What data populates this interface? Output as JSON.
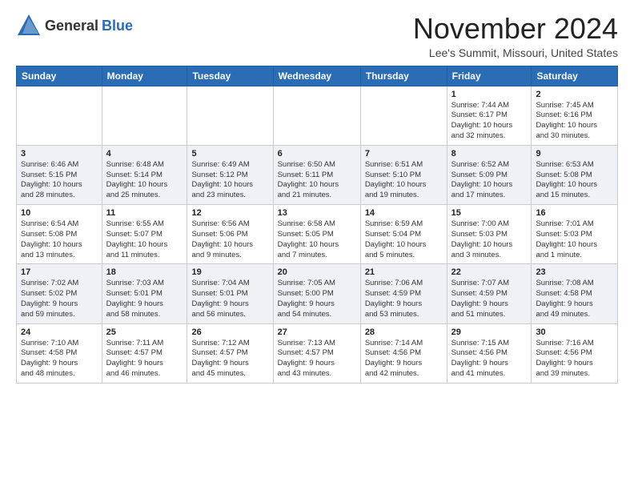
{
  "header": {
    "logo_general": "General",
    "logo_blue": "Blue",
    "month_title": "November 2024",
    "location": "Lee's Summit, Missouri, United States"
  },
  "weekdays": [
    "Sunday",
    "Monday",
    "Tuesday",
    "Wednesday",
    "Thursday",
    "Friday",
    "Saturday"
  ],
  "weeks": [
    [
      {
        "day": "",
        "info": ""
      },
      {
        "day": "",
        "info": ""
      },
      {
        "day": "",
        "info": ""
      },
      {
        "day": "",
        "info": ""
      },
      {
        "day": "",
        "info": ""
      },
      {
        "day": "1",
        "info": "Sunrise: 7:44 AM\nSunset: 6:17 PM\nDaylight: 10 hours\nand 32 minutes."
      },
      {
        "day": "2",
        "info": "Sunrise: 7:45 AM\nSunset: 6:16 PM\nDaylight: 10 hours\nand 30 minutes."
      }
    ],
    [
      {
        "day": "3",
        "info": "Sunrise: 6:46 AM\nSunset: 5:15 PM\nDaylight: 10 hours\nand 28 minutes."
      },
      {
        "day": "4",
        "info": "Sunrise: 6:48 AM\nSunset: 5:14 PM\nDaylight: 10 hours\nand 25 minutes."
      },
      {
        "day": "5",
        "info": "Sunrise: 6:49 AM\nSunset: 5:12 PM\nDaylight: 10 hours\nand 23 minutes."
      },
      {
        "day": "6",
        "info": "Sunrise: 6:50 AM\nSunset: 5:11 PM\nDaylight: 10 hours\nand 21 minutes."
      },
      {
        "day": "7",
        "info": "Sunrise: 6:51 AM\nSunset: 5:10 PM\nDaylight: 10 hours\nand 19 minutes."
      },
      {
        "day": "8",
        "info": "Sunrise: 6:52 AM\nSunset: 5:09 PM\nDaylight: 10 hours\nand 17 minutes."
      },
      {
        "day": "9",
        "info": "Sunrise: 6:53 AM\nSunset: 5:08 PM\nDaylight: 10 hours\nand 15 minutes."
      }
    ],
    [
      {
        "day": "10",
        "info": "Sunrise: 6:54 AM\nSunset: 5:08 PM\nDaylight: 10 hours\nand 13 minutes."
      },
      {
        "day": "11",
        "info": "Sunrise: 6:55 AM\nSunset: 5:07 PM\nDaylight: 10 hours\nand 11 minutes."
      },
      {
        "day": "12",
        "info": "Sunrise: 6:56 AM\nSunset: 5:06 PM\nDaylight: 10 hours\nand 9 minutes."
      },
      {
        "day": "13",
        "info": "Sunrise: 6:58 AM\nSunset: 5:05 PM\nDaylight: 10 hours\nand 7 minutes."
      },
      {
        "day": "14",
        "info": "Sunrise: 6:59 AM\nSunset: 5:04 PM\nDaylight: 10 hours\nand 5 minutes."
      },
      {
        "day": "15",
        "info": "Sunrise: 7:00 AM\nSunset: 5:03 PM\nDaylight: 10 hours\nand 3 minutes."
      },
      {
        "day": "16",
        "info": "Sunrise: 7:01 AM\nSunset: 5:03 PM\nDaylight: 10 hours\nand 1 minute."
      }
    ],
    [
      {
        "day": "17",
        "info": "Sunrise: 7:02 AM\nSunset: 5:02 PM\nDaylight: 9 hours\nand 59 minutes."
      },
      {
        "day": "18",
        "info": "Sunrise: 7:03 AM\nSunset: 5:01 PM\nDaylight: 9 hours\nand 58 minutes."
      },
      {
        "day": "19",
        "info": "Sunrise: 7:04 AM\nSunset: 5:01 PM\nDaylight: 9 hours\nand 56 minutes."
      },
      {
        "day": "20",
        "info": "Sunrise: 7:05 AM\nSunset: 5:00 PM\nDaylight: 9 hours\nand 54 minutes."
      },
      {
        "day": "21",
        "info": "Sunrise: 7:06 AM\nSunset: 4:59 PM\nDaylight: 9 hours\nand 53 minutes."
      },
      {
        "day": "22",
        "info": "Sunrise: 7:07 AM\nSunset: 4:59 PM\nDaylight: 9 hours\nand 51 minutes."
      },
      {
        "day": "23",
        "info": "Sunrise: 7:08 AM\nSunset: 4:58 PM\nDaylight: 9 hours\nand 49 minutes."
      }
    ],
    [
      {
        "day": "24",
        "info": "Sunrise: 7:10 AM\nSunset: 4:58 PM\nDaylight: 9 hours\nand 48 minutes."
      },
      {
        "day": "25",
        "info": "Sunrise: 7:11 AM\nSunset: 4:57 PM\nDaylight: 9 hours\nand 46 minutes."
      },
      {
        "day": "26",
        "info": "Sunrise: 7:12 AM\nSunset: 4:57 PM\nDaylight: 9 hours\nand 45 minutes."
      },
      {
        "day": "27",
        "info": "Sunrise: 7:13 AM\nSunset: 4:57 PM\nDaylight: 9 hours\nand 43 minutes."
      },
      {
        "day": "28",
        "info": "Sunrise: 7:14 AM\nSunset: 4:56 PM\nDaylight: 9 hours\nand 42 minutes."
      },
      {
        "day": "29",
        "info": "Sunrise: 7:15 AM\nSunset: 4:56 PM\nDaylight: 9 hours\nand 41 minutes."
      },
      {
        "day": "30",
        "info": "Sunrise: 7:16 AM\nSunset: 4:56 PM\nDaylight: 9 hours\nand 39 minutes."
      }
    ]
  ]
}
